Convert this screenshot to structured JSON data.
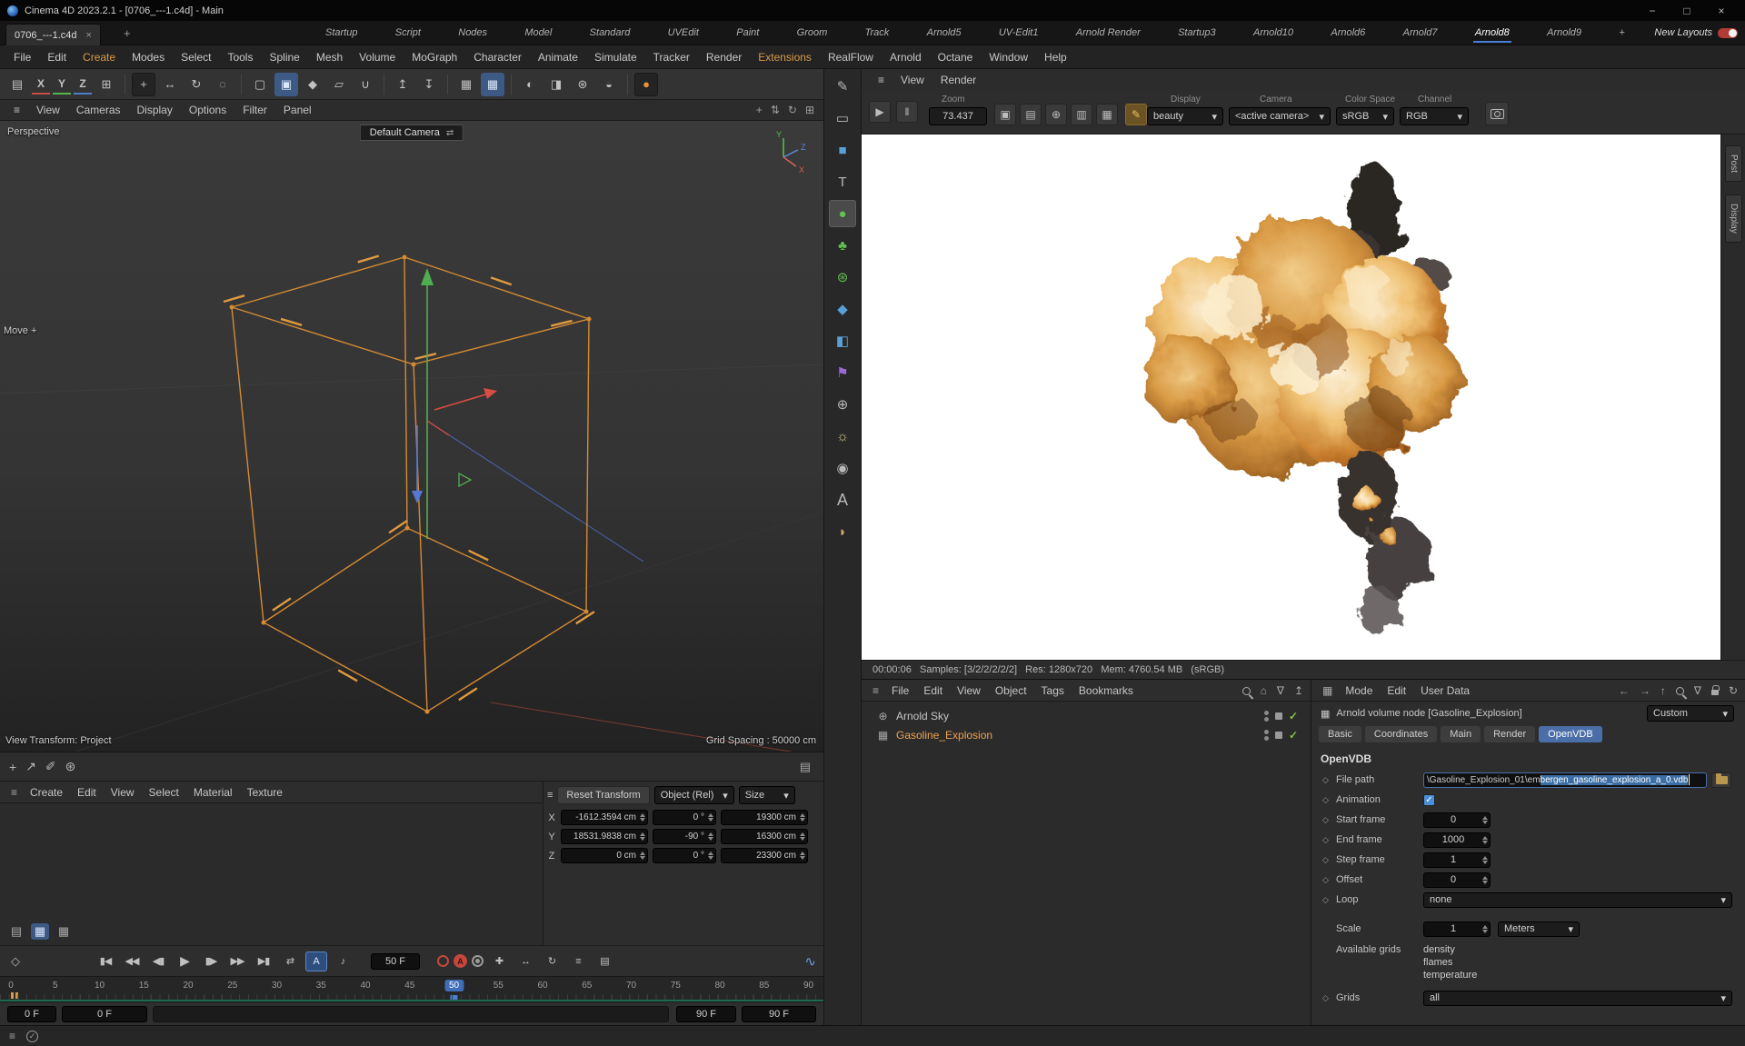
{
  "colors": {
    "accent_blue": "#4a7fd6",
    "selection_blue": "#3f6db8",
    "tab_active_blue": "#4a6fa8",
    "wire_orange": "#d58a33",
    "menu_highlight": "#d79b4a",
    "green_check": "#84c341",
    "selected_object_orange": "#f0a050",
    "autokey_red": "#c4473d"
  },
  "icons": {
    "hamburger": "≡",
    "close": "×",
    "minimize": "−",
    "maximize": "□",
    "plus": "+",
    "dropdown": "▾",
    "check": "✓",
    "diamond": "◇",
    "grid": "▦",
    "home": "⌂",
    "funnel": "∇",
    "export": "↥",
    "back": "←",
    "forward": "→",
    "up": "↑",
    "refresh": "↻",
    "swap": "⇄",
    "note": "♪",
    "wave": "∿",
    "box": "▤",
    "loop": "⇄",
    "pen": "✐",
    "gear": "⊛",
    "arrow_ne": "↗"
  },
  "title_bar": {
    "title": "Cinema 4D 2023.2.1 - [0706_---1.c4d] - Main"
  },
  "tab_bar": {
    "document_tab": "0706_---1.c4d",
    "layout_tabs": [
      "Startup",
      "Script",
      "Nodes",
      "Model",
      "Standard",
      "UVEdit",
      "Paint",
      "Groom",
      "Track",
      "Arnold5",
      "UV-Edit1",
      "Arnold Render",
      "Startup3",
      "Arnold10",
      "Arnold6",
      "Arnold7",
      "Arnold8",
      "Arnold9"
    ],
    "active_tab": "Arnold8",
    "new_layouts_label": "New Layouts"
  },
  "menu_bar": {
    "items": [
      "File",
      "Edit",
      "Create",
      "Modes",
      "Select",
      "Tools",
      "Spline",
      "Mesh",
      "Volume",
      "MoGraph",
      "Character",
      "Animate",
      "Simulate",
      "Tracker",
      "Render",
      "Extensions",
      "RealFlow",
      "Arnold",
      "Octane",
      "Window",
      "Help"
    ]
  },
  "main_toolbar": {
    "buttons": [
      {
        "name": "workplane-panel-button",
        "glyph": "▤"
      },
      {
        "name": "x-lock-button",
        "glyph": "X"
      },
      {
        "name": "y-lock-button",
        "glyph": "Y"
      },
      {
        "name": "z-lock-button",
        "glyph": "Z"
      },
      {
        "name": "coord-system-button",
        "glyph": "⊞"
      },
      {
        "name": "move-tool-button",
        "glyph": "+"
      },
      {
        "name": "scale-tool-button",
        "glyph": "↔"
      },
      {
        "name": "rotate-tool-button",
        "glyph": "↻"
      },
      {
        "name": "last-tool-button",
        "glyph": "◌"
      },
      {
        "name": "selection-filter-button",
        "glyph": "▢"
      },
      {
        "name": "modeling-axis-button",
        "glyph": "▣"
      },
      {
        "name": "axis-lock-button",
        "glyph": "◆"
      },
      {
        "name": "workplane-button",
        "glyph": "▱"
      },
      {
        "name": "snap-button",
        "glyph": "∪"
      },
      {
        "name": "move-up-button",
        "glyph": "↥"
      },
      {
        "name": "move-down-button",
        "glyph": "↧"
      },
      {
        "name": "grid-button",
        "glyph": "▦"
      },
      {
        "name": "grid-snap-button",
        "glyph": "▦"
      },
      {
        "name": "render-view-button",
        "glyph": "◐"
      },
      {
        "name": "render-picture-button",
        "glyph": "◨"
      },
      {
        "name": "render-settings-button",
        "glyph": "⊛"
      },
      {
        "name": "interactive-render-button",
        "glyph": "◒"
      },
      {
        "name": "arnold-render-button",
        "glyph": "●"
      }
    ]
  },
  "viewport": {
    "menu": [
      "View",
      "Cameras",
      "Display",
      "Options",
      "Filter",
      "Panel"
    ],
    "corner_icons": [
      {
        "name": "pan-view-icon",
        "glyph": "+"
      },
      {
        "name": "dolly-view-icon",
        "glyph": "⇅"
      },
      {
        "name": "rotate-view-icon",
        "glyph": "↻"
      },
      {
        "name": "toggle-view-icon",
        "glyph": "⊞"
      }
    ],
    "perspective_label": "Perspective",
    "camera_label": "Default Camera",
    "move_label": "Move",
    "view_transform_label": "View Transform: Project",
    "grid_spacing_label": "Grid Spacing : 50000 cm",
    "axis_labels": {
      "x": "X",
      "y": "Y",
      "z": "Z"
    }
  },
  "palette": {
    "items": [
      {
        "name": "tweak-mode-icon",
        "glyph": "✎"
      },
      {
        "name": "plane-object-icon",
        "glyph": "▭"
      },
      {
        "name": "cube-object-icon",
        "glyph": "■"
      },
      {
        "name": "text-object-icon",
        "glyph": "T"
      },
      {
        "name": "volume-object-icon",
        "glyph": "●"
      },
      {
        "name": "vegetation-object-icon",
        "glyph": "♣"
      },
      {
        "name": "generator-object-icon",
        "glyph": "⊛"
      },
      {
        "name": "spline-object-icon",
        "glyph": "◆"
      },
      {
        "name": "mograph-object-icon",
        "glyph": "◧"
      },
      {
        "name": "deformer-object-icon",
        "glyph": "⚑"
      },
      {
        "name": "sky-object-icon",
        "glyph": "⊕"
      },
      {
        "name": "light-object-icon",
        "glyph": "☼"
      },
      {
        "name": "camera-object-icon",
        "glyph": "◉"
      },
      {
        "name": "material-object-icon",
        "glyph": "A"
      },
      {
        "name": "environment-object-icon",
        "glyph": "◗"
      }
    ]
  },
  "render_view": {
    "menus": [
      "View",
      "Render"
    ],
    "play_glyph": "▶",
    "pause_glyph": "‖",
    "zoom_label": "Zoom",
    "zoom_value": "73.437",
    "toolbar_icons": [
      {
        "name": "snapshot-icon",
        "glyph": "▣"
      },
      {
        "name": "compare-icon",
        "glyph": "▤"
      },
      {
        "name": "region-render-icon",
        "glyph": "⊕"
      },
      {
        "name": "expand-icon",
        "glyph": "▥"
      },
      {
        "name": "grid-icon",
        "glyph": "▦"
      },
      {
        "name": "debug-shading-icon",
        "glyph": "✎"
      }
    ],
    "display": {
      "label": "Display",
      "value": "beauty"
    },
    "camera": {
      "label": "Camera",
      "value": "<active camera>"
    },
    "colorspace": {
      "label": "Color Space",
      "value": "sRGB"
    },
    "channel": {
      "label": "Channel",
      "value": "RGB"
    },
    "side_tabs": [
      "Post",
      "Display"
    ],
    "status": "00:00:06   Samples: [3/2/2/2/2/2]   Res: 1280x720   Mem: 4760.54 MB   (sRGB)"
  },
  "object_manager": {
    "menus": [
      "File",
      "Edit",
      "View",
      "Object",
      "Tags",
      "Bookmarks"
    ],
    "objects": [
      {
        "name": "Arnold Sky",
        "icon": "⊕",
        "selected": false
      },
      {
        "name": "Gasoline_Explosion",
        "icon": "▦",
        "selected": true
      }
    ]
  },
  "attribute_manager": {
    "menus": [
      "Mode",
      "Edit",
      "User Data"
    ],
    "title": "Arnold volume node [Gasoline_Explosion]",
    "preset": "Custom",
    "tabs": [
      "Basic",
      "Coordinates",
      "Main",
      "Render",
      "OpenVDB"
    ],
    "active_tab": "OpenVDB",
    "section_title": "OpenVDB",
    "rows": {
      "file_path_label": "File path",
      "file_path_prefix": "\\Gasoline_Explosion_01\\em",
      "file_path_selected": "bergen_gasoline_explosion_a_0.vdb",
      "animation_label": "Animation",
      "start_frame_label": "Start frame",
      "start_frame": "0",
      "end_frame_label": "End frame",
      "end_frame": "1000",
      "step_frame_label": "Step frame",
      "step_frame": "1",
      "offset_label": "Offset",
      "offset": "0",
      "loop_label": "Loop",
      "loop": "none",
      "scale_label": "Scale",
      "scale": "1",
      "scale_unit": "Meters",
      "available_grids_label": "Available grids",
      "available_grids": [
        "density",
        "flames",
        "temperature"
      ],
      "grids_label": "Grids",
      "grids": "all"
    }
  },
  "coordinates_panel": {
    "reset_button": "Reset Transform",
    "mode_dropdown": "Object (Rel)",
    "size_dropdown": "Size",
    "rows": [
      {
        "axis": "X",
        "position": "-1612.3594 cm",
        "rotation": "0 °",
        "size": "19300 cm"
      },
      {
        "axis": "Y",
        "position": "18531.9838 cm",
        "rotation": "-90 °",
        "size": "16300 cm"
      },
      {
        "axis": "Z",
        "position": "0 cm",
        "rotation": "0 °",
        "size": "23300 cm"
      }
    ]
  },
  "material_manager": {
    "menus": [
      "Create",
      "Edit",
      "View",
      "Select",
      "Material",
      "Texture"
    ]
  },
  "timeline": {
    "transport": [
      {
        "name": "goto-start-button",
        "glyph": "▮◀"
      },
      {
        "name": "prev-key-button",
        "glyph": "◀◀"
      },
      {
        "name": "prev-frame-button",
        "glyph": "◀▮"
      },
      {
        "name": "play-button",
        "glyph": "▶"
      },
      {
        "name": "next-frame-button",
        "glyph": "▮▶"
      },
      {
        "name": "next-key-button",
        "glyph": "▶▶"
      },
      {
        "name": "goto-end-button",
        "glyph": "▶▮"
      }
    ],
    "loop_glyph": "⇄",
    "playmode_glyph": "A",
    "sound_glyph": "♪",
    "current_frame": "50 F",
    "key_icons": [
      {
        "name": "key-position-button",
        "glyph": "✚"
      },
      {
        "name": "key-scale-button",
        "glyph": "↔"
      },
      {
        "name": "key-rotation-button",
        "glyph": "↻"
      },
      {
        "name": "key-parameter-button",
        "glyph": "≡"
      },
      {
        "name": "key-pla-button",
        "glyph": "▤"
      }
    ],
    "ticks": [
      0,
      5,
      10,
      15,
      20,
      25,
      30,
      35,
      40,
      45,
      50,
      55,
      60,
      65,
      70,
      75,
      80,
      85,
      90
    ],
    "current_tick": 50,
    "range": {
      "start_a": "0 F",
      "start_b": "0 F",
      "end_a": "90 F",
      "end_b": "90 F"
    }
  }
}
